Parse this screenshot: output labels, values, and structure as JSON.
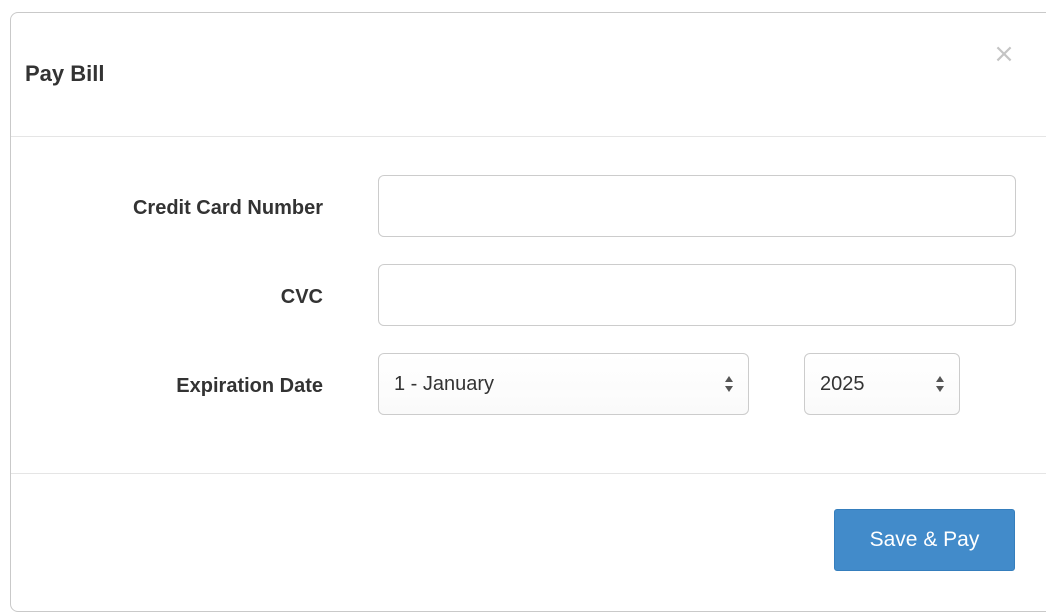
{
  "modal": {
    "title": "Pay Bill",
    "close_label": "×"
  },
  "form": {
    "card_number": {
      "label": "Credit Card Number",
      "value": "",
      "placeholder": ""
    },
    "cvc": {
      "label": "CVC",
      "value": "",
      "placeholder": ""
    },
    "expiration": {
      "label": "Expiration Date",
      "month_selected": "1 - January",
      "year_selected": "2025"
    }
  },
  "footer": {
    "submit_label": "Save & Pay"
  },
  "colors": {
    "primary_button": "#428bca",
    "divider": "#e5e5e5",
    "close_icon": "#c4c4c4"
  },
  "icons": {
    "close": "close-icon",
    "select_arrows": "sort-arrows-icon"
  }
}
